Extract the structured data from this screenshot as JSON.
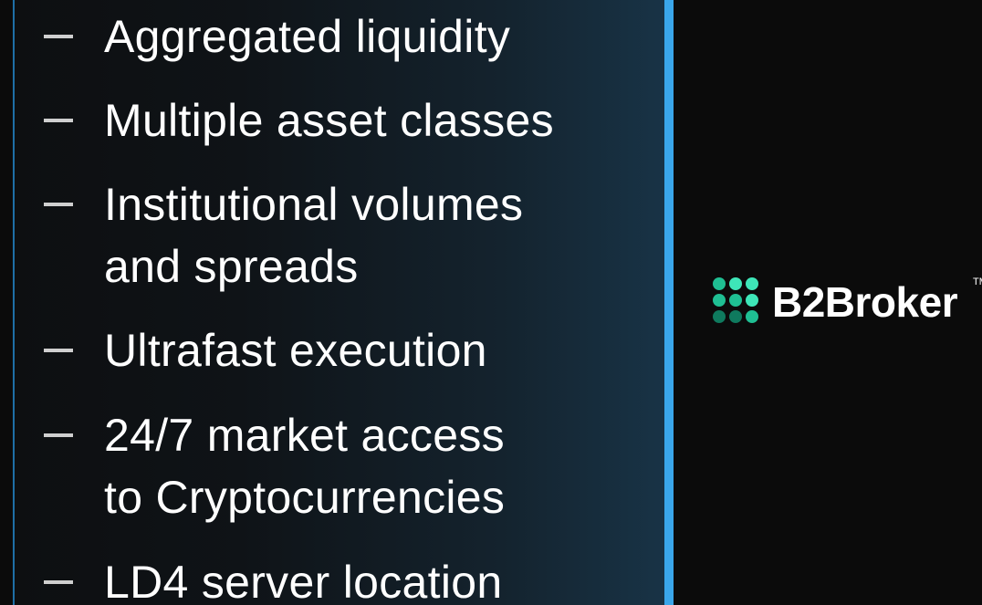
{
  "features": [
    {
      "lines": [
        "Aggregated liquidity"
      ]
    },
    {
      "lines": [
        "Multiple asset classes"
      ]
    },
    {
      "lines": [
        "Institutional volumes",
        "and spreads"
      ]
    },
    {
      "lines": [
        "Ultrafast execution"
      ]
    },
    {
      "lines": [
        "24/7 market access",
        "to Cryptocurrencies"
      ]
    },
    {
      "lines": [
        "LD4 server location"
      ]
    }
  ],
  "brand": {
    "name": "B2Broker",
    "trademark": "TM",
    "icon": "b2broker-dot-grid-icon",
    "colors": {
      "mark_light": "#3ee6b8",
      "mark_mid": "#1fbf93",
      "mark_dark": "#0f7a5e",
      "accent_bar": "#3aa6ea"
    }
  }
}
